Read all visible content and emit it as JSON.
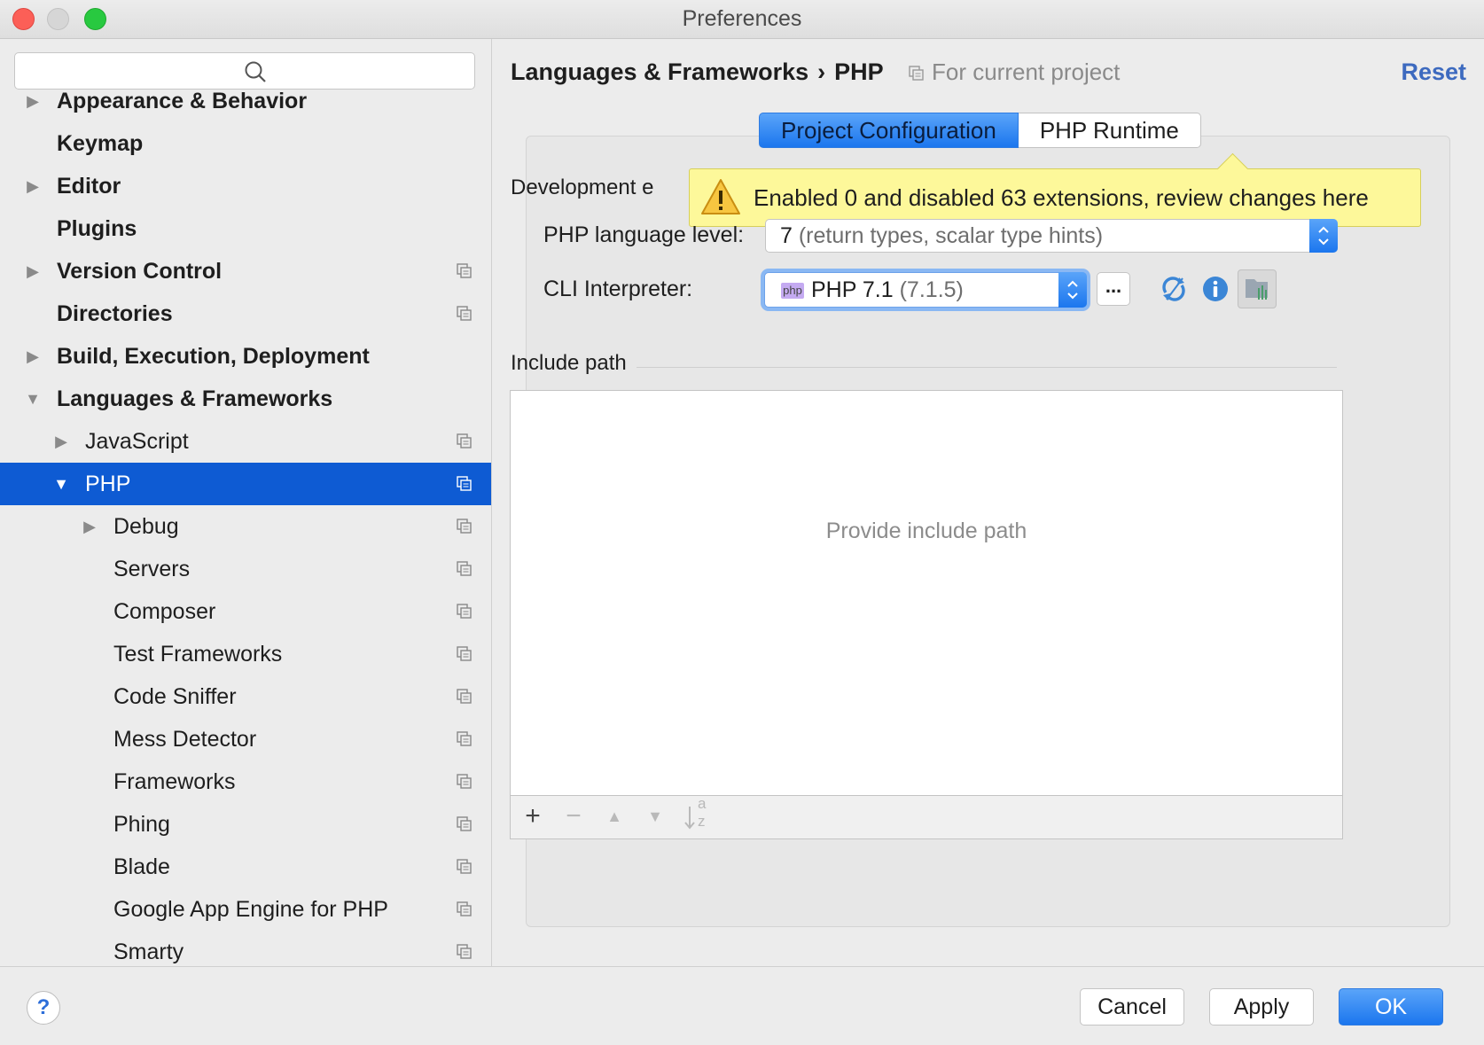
{
  "window": {
    "title": "Preferences"
  },
  "sidebar": {
    "search_placeholder": "",
    "items": [
      {
        "label": "Appearance & Behavior",
        "bold": true
      },
      {
        "label": "Keymap",
        "bold": true
      },
      {
        "label": "Editor",
        "bold": true
      },
      {
        "label": "Plugins",
        "bold": true
      },
      {
        "label": "Version Control",
        "bold": true
      },
      {
        "label": "Directories",
        "bold": true
      },
      {
        "label": "Build, Execution, Deployment",
        "bold": true
      },
      {
        "label": "Languages & Frameworks",
        "bold": true
      },
      {
        "label": "JavaScript"
      },
      {
        "label": "PHP",
        "selected": true
      },
      {
        "label": "Debug"
      },
      {
        "label": "Servers"
      },
      {
        "label": "Composer"
      },
      {
        "label": "Test Frameworks"
      },
      {
        "label": "Code Sniffer"
      },
      {
        "label": "Mess Detector"
      },
      {
        "label": "Frameworks"
      },
      {
        "label": "Phing"
      },
      {
        "label": "Blade"
      },
      {
        "label": "Google App Engine for PHP"
      },
      {
        "label": "Smarty"
      }
    ]
  },
  "header": {
    "breadcrumb_parent": "Languages & Frameworks",
    "breadcrumb_sep": "›",
    "breadcrumb_current": "PHP",
    "scope": "For current project",
    "reset_label": "Reset"
  },
  "tabs": [
    {
      "label": "Project Configuration",
      "active": true
    },
    {
      "label": "PHP Runtime",
      "active": false
    }
  ],
  "development_section": {
    "label": "Development e"
  },
  "tooltip": {
    "text": "Enabled 0 and disabled 63 extensions, review changes here"
  },
  "language_level": {
    "label": "PHP language level:",
    "value": "7",
    "detail": "(return types, scalar type hints)"
  },
  "cli_interpreter": {
    "label": "CLI Interpreter:",
    "badge": "php",
    "value": "PHP 7.1",
    "detail": "(7.1.5)",
    "browse_label": "..."
  },
  "include_path": {
    "label": "Include path",
    "empty_text": "Provide include path",
    "toolbar": {
      "add": "+",
      "remove": "−",
      "up": "▲",
      "down": "▼",
      "sort_top": "a",
      "sort_bottom": "z"
    }
  },
  "footer": {
    "help_label": "?",
    "cancel_label": "Cancel",
    "apply_label": "Apply",
    "ok_label": "OK"
  },
  "colors": {
    "accent": "#0e5bd3",
    "tooltip_bg": "#fdf89a",
    "link": "#3d6abf"
  }
}
